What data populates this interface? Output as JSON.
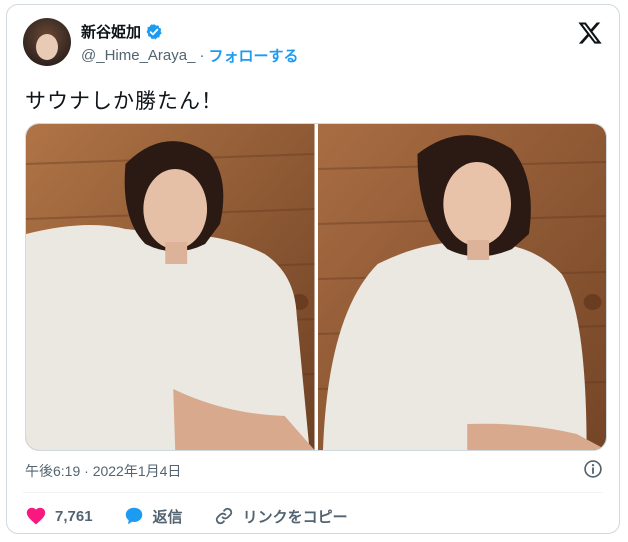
{
  "author": {
    "display_name": "新谷姫加",
    "handle": "@_Hime_Araya_",
    "separator": "·",
    "follow_label": "フォローする"
  },
  "tweet": {
    "text": "サウナしか勝たん！",
    "timestamp": "午後6:19 · 2022年1月4日"
  },
  "actions": {
    "likes": "7,761",
    "reply_label": "返信",
    "copy_link_label": "リンクをコピー"
  },
  "colors": {
    "accent": "#1d9bf0",
    "like": "#f91880",
    "text": "#0f1419",
    "muted": "#536471"
  },
  "icons": [
    "verified-badge-icon",
    "x-logo-icon",
    "info-icon",
    "heart-icon",
    "reply-bubble-icon",
    "link-icon"
  ]
}
